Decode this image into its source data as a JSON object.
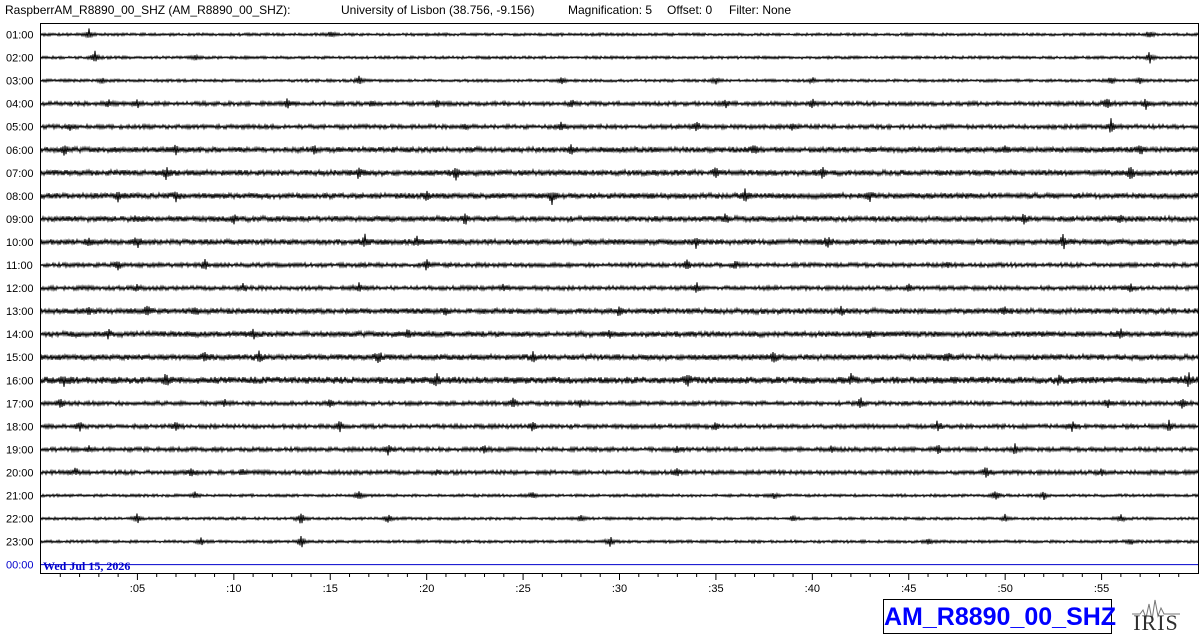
{
  "header": {
    "station_info": "RaspberrAM_R8890_00_SHZ (AM_R8890_00_SHZ):",
    "location": "University of Lisbon (38.756, -9.156)",
    "magnification": "Magnification: 5",
    "offset": "Offset: 0",
    "filter": "Filter: None"
  },
  "chart_data": {
    "type": "line",
    "title": "",
    "xlabel": "",
    "ylabel": "",
    "y_labels": [
      "01:00",
      "02:00",
      "03:00",
      "04:00",
      "05:00",
      "06:00",
      "07:00",
      "08:00",
      "09:00",
      "10:00",
      "11:00",
      "12:00",
      "13:00",
      "14:00",
      "15:00",
      "16:00",
      "17:00",
      "18:00",
      "19:00",
      "20:00",
      "21:00",
      "22:00",
      "23:00",
      "00:00"
    ],
    "x_ticks": [
      ":05",
      ":10",
      ":15",
      ":20",
      ":25",
      ":30",
      ":35",
      ":40",
      ":45",
      ":50",
      ":55"
    ],
    "x_tick_minutes": [
      5,
      10,
      15,
      20,
      25,
      30,
      35,
      40,
      45,
      50,
      55
    ],
    "xlim": [
      0,
      60
    ],
    "date_label": "Wed Jul 15, 2026",
    "trace_color": "#000000",
    "current_line_color": "#0000cc",
    "noise_level": [
      2,
      2,
      2,
      3,
      3,
      4,
      4,
      4,
      4,
      4,
      3,
      3,
      4,
      4,
      4,
      5,
      3,
      3,
      3,
      3,
      2,
      2,
      2,
      0
    ],
    "events": [
      [
        [
          2.5,
          10
        ],
        [
          15,
          5
        ],
        [
          57.5,
          8
        ]
      ],
      [
        [
          2.8,
          14
        ],
        [
          8,
          4
        ],
        [
          57.5,
          10
        ]
      ],
      [
        [
          3.2,
          5
        ],
        [
          16.5,
          8
        ],
        [
          27,
          6
        ],
        [
          35,
          6
        ],
        [
          40,
          5
        ],
        [
          55.5,
          7
        ],
        [
          57,
          6
        ]
      ],
      [
        [
          3.5,
          7
        ],
        [
          5,
          8
        ],
        [
          12.8,
          9
        ],
        [
          17.2,
          6
        ],
        [
          20.5,
          6
        ],
        [
          27.5,
          7
        ],
        [
          35.5,
          6
        ],
        [
          40,
          8
        ],
        [
          55.3,
          12
        ],
        [
          57.3,
          9
        ]
      ],
      [
        [
          1.5,
          5
        ],
        [
          22,
          6
        ],
        [
          27,
          7
        ],
        [
          34,
          8
        ],
        [
          39,
          6
        ],
        [
          55.5,
          14
        ]
      ],
      [
        [
          1.2,
          8
        ],
        [
          7,
          7
        ],
        [
          14.2,
          6
        ],
        [
          27.5,
          9
        ],
        [
          37,
          6
        ],
        [
          50,
          5
        ],
        [
          57,
          8
        ]
      ],
      [
        [
          6.5,
          9
        ],
        [
          16.5,
          10
        ],
        [
          21.5,
          12
        ],
        [
          35,
          10
        ],
        [
          40.5,
          11
        ],
        [
          56.5,
          12
        ]
      ],
      [
        [
          4,
          8
        ],
        [
          7,
          9
        ],
        [
          20,
          7
        ],
        [
          26.5,
          11
        ],
        [
          36.5,
          12
        ],
        [
          43,
          7
        ]
      ],
      [
        [
          5,
          6
        ],
        [
          10,
          7
        ],
        [
          22,
          8
        ],
        [
          35.5,
          6
        ],
        [
          51,
          9
        ],
        [
          56,
          7
        ]
      ],
      [
        [
          2.5,
          6
        ],
        [
          5,
          9
        ],
        [
          16.8,
          12
        ],
        [
          19.5,
          8
        ],
        [
          34,
          10
        ],
        [
          40.8,
          9
        ],
        [
          53,
          12
        ]
      ],
      [
        [
          4,
          8
        ],
        [
          8.5,
          10
        ],
        [
          20,
          9
        ],
        [
          33.5,
          8
        ],
        [
          36,
          7
        ],
        [
          47,
          5
        ]
      ],
      [
        [
          5,
          7
        ],
        [
          10.5,
          8
        ],
        [
          16.5,
          10
        ],
        [
          24,
          6
        ],
        [
          34,
          9
        ],
        [
          45,
          7
        ],
        [
          56.5,
          8
        ]
      ],
      [
        [
          2.5,
          6
        ],
        [
          5.5,
          9
        ],
        [
          8,
          8
        ],
        [
          21,
          7
        ],
        [
          30,
          8
        ],
        [
          41.5,
          9
        ],
        [
          50,
          6
        ]
      ],
      [
        [
          3.5,
          7
        ],
        [
          11,
          8
        ],
        [
          19,
          6
        ],
        [
          29.5,
          8
        ],
        [
          43,
          7
        ],
        [
          56,
          8
        ]
      ],
      [
        [
          8.5,
          8
        ],
        [
          11.3,
          10
        ],
        [
          17.5,
          12
        ],
        [
          25.5,
          10
        ],
        [
          38,
          9
        ],
        [
          47,
          7
        ]
      ],
      [
        [
          1.2,
          10
        ],
        [
          6.5,
          9
        ],
        [
          20.5,
          11
        ],
        [
          33.5,
          11
        ],
        [
          42,
          7
        ],
        [
          52.8,
          8
        ],
        [
          59.5,
          12
        ]
      ],
      [
        [
          1,
          8
        ],
        [
          9.5,
          7
        ],
        [
          15,
          6
        ],
        [
          24.5,
          10
        ],
        [
          28,
          7
        ],
        [
          42.5,
          9
        ],
        [
          55.3,
          8
        ],
        [
          59.2,
          10
        ]
      ],
      [
        [
          2,
          8
        ],
        [
          7,
          7
        ],
        [
          15.5,
          9
        ],
        [
          25.5,
          8
        ],
        [
          35,
          6
        ],
        [
          46.5,
          10
        ],
        [
          53.5,
          8
        ],
        [
          58.5,
          9
        ]
      ],
      [
        [
          2.5,
          6
        ],
        [
          18,
          9
        ],
        [
          23,
          7
        ],
        [
          33,
          6
        ],
        [
          41,
          7
        ],
        [
          46.5,
          9
        ],
        [
          50.5,
          8
        ]
      ],
      [
        [
          1.8,
          6
        ],
        [
          7.8,
          9
        ],
        [
          10.5,
          6
        ],
        [
          20.5,
          5
        ],
        [
          33,
          6
        ],
        [
          49,
          9
        ],
        [
          55,
          7
        ]
      ],
      [
        [
          8,
          7
        ],
        [
          16.5,
          9
        ],
        [
          25.5,
          6
        ],
        [
          38,
          5
        ],
        [
          49.5,
          10
        ],
        [
          52,
          7
        ]
      ],
      [
        [
          5,
          9
        ],
        [
          13.5,
          12
        ],
        [
          18,
          8
        ],
        [
          28,
          6
        ],
        [
          39,
          6
        ],
        [
          50,
          7
        ],
        [
          56,
          6
        ]
      ],
      [
        [
          8.3,
          8
        ],
        [
          13.5,
          12
        ],
        [
          29.5,
          10
        ],
        [
          46,
          5
        ],
        [
          56.5,
          6
        ]
      ],
      []
    ]
  },
  "footer": {
    "channel_label": "AM_R8890_00_SHZ",
    "logo_text": "IRIS",
    "logo_name": "iris-logo"
  }
}
